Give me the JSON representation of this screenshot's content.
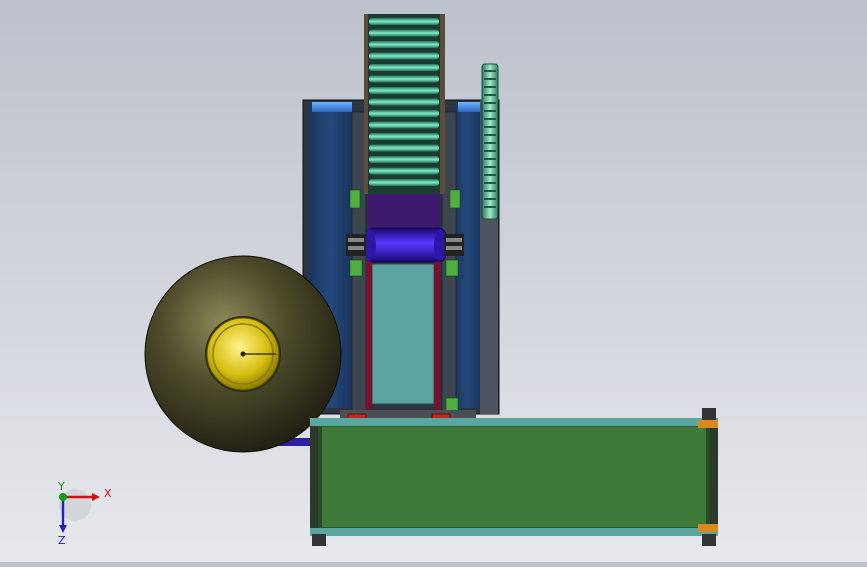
{
  "viewport": {
    "background_top": "#bcc1cb",
    "background_bottom": "#e6e8ec"
  },
  "model": {
    "colors": {
      "frame_blue": "#1f3f6e",
      "frame_edge": "#3a4a5c",
      "roller_green": "#4fd1a3",
      "roller_dark": "#1e6e5a",
      "purple_roller": "#3a12c8",
      "teal_panel": "#5aa3a0",
      "conveyor_green": "#3f7a3b",
      "spool_dark": "#3a3a20",
      "spool_gold": "#c9b100",
      "red_bracket": "#c0281c",
      "orange_band": "#d98a1a"
    }
  },
  "triad": {
    "x_label": "X",
    "y_label": "Y",
    "z_label": "Z",
    "x_color": "#d01010",
    "y_color": "#10a010",
    "z_color": "#2020c0"
  }
}
